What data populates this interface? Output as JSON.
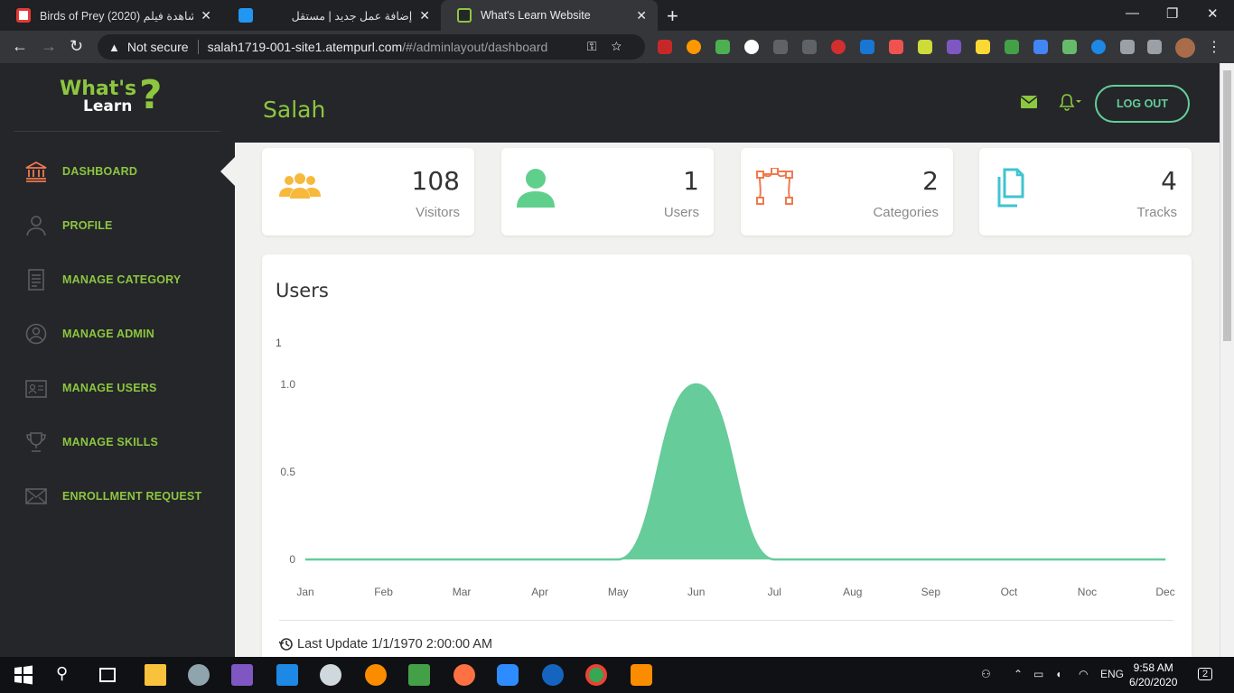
{
  "browser": {
    "tabs": [
      {
        "title": "Birds of Prey (2020) مشاهدة فيلم",
        "favicon_color": "#e53935"
      },
      {
        "title": "إضافة عمل جديد | مستقل",
        "favicon_color": "#2196f3"
      },
      {
        "title": "What's Learn Website",
        "favicon_color": "#8dc63f"
      }
    ],
    "address": {
      "security": "Not secure",
      "host": "salah1719-001-site1.atempurl.com",
      "path": "/#/adminlayout/dashboard"
    }
  },
  "app": {
    "logo": {
      "word1": "What's",
      "word2": "Learn",
      "mark": "?"
    },
    "page_title": "Salah",
    "logout_label": "LOG OUT",
    "nav": [
      {
        "label": "DASHBOARD",
        "icon": "bank-icon",
        "active": true
      },
      {
        "label": "PROFILE",
        "icon": "user-icon",
        "active": false
      },
      {
        "label": "MANAGE CATEGORY",
        "icon": "document-icon",
        "active": false
      },
      {
        "label": "MANAGE ADMIN",
        "icon": "user-circle-icon",
        "active": false
      },
      {
        "label": "MANAGE USERS",
        "icon": "id-card-icon",
        "active": false
      },
      {
        "label": "MANAGE SKILLS",
        "icon": "trophy-icon",
        "active": false
      },
      {
        "label": "ENROLLMENT REQUEST",
        "icon": "envelope-icon",
        "active": false
      }
    ],
    "stats": [
      {
        "value": "108",
        "caption": "Visitors",
        "icon": "group-icon",
        "color": "#f6b93b"
      },
      {
        "value": "1",
        "caption": "Users",
        "icon": "single-user-icon",
        "color": "#5fcf8c"
      },
      {
        "value": "2",
        "caption": "Categories",
        "icon": "vector-nodes-icon",
        "color": "#f07a4f"
      },
      {
        "value": "4",
        "caption": "Tracks",
        "icon": "copy-icon",
        "color": "#3fc4d0"
      }
    ],
    "accent_green": "#8dc63f",
    "chart_fill": "#66cc99"
  },
  "chart_data": {
    "type": "area",
    "title": "Users",
    "y_top_label": "1",
    "categories": [
      "Jan",
      "Feb",
      "Mar",
      "Apr",
      "May",
      "Jun",
      "Jul",
      "Aug",
      "Sep",
      "Oct",
      "Noc",
      "Dec"
    ],
    "values": [
      0,
      0,
      0,
      0,
      0,
      1,
      0,
      0,
      0,
      0,
      0,
      0
    ],
    "yticks": [
      "1.0",
      "0.5",
      "0"
    ],
    "ylim": [
      0,
      1
    ],
    "last_update": "Last Update 1/1/1970 2:00:00 AM"
  },
  "taskbar": {
    "tray_lang": "ENG",
    "time": "9:58 AM",
    "date": "6/20/2020",
    "notifications": "2"
  }
}
